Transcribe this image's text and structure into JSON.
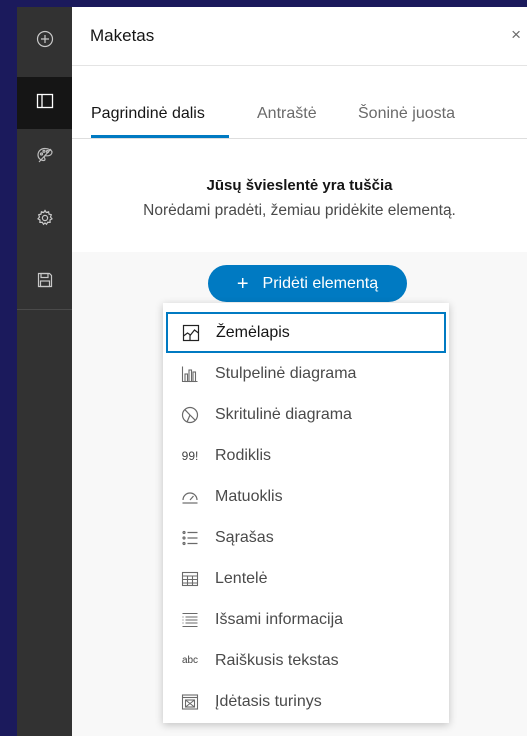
{
  "rail": {
    "items": [
      {
        "icon": "add-circle-icon"
      },
      {
        "icon": "layout-icon",
        "active": true
      },
      {
        "icon": "palette-icon"
      },
      {
        "icon": "gear-icon"
      },
      {
        "icon": "save-icon"
      }
    ]
  },
  "panel": {
    "title": "Maketas",
    "close": "×",
    "tabs": [
      {
        "label": "Pagrindinė dalis",
        "active": true
      },
      {
        "label": "Antraštė"
      },
      {
        "label": "Šoninė juosta"
      }
    ],
    "empty_title": "Jūsų švieslentė yra tuščia",
    "empty_subtitle": "Norėdami pradėti, žemiau pridėkite elementą.",
    "add_button": {
      "plus": "+",
      "label": "Pridėti elementą"
    }
  },
  "menu": {
    "items": [
      {
        "label": "Žemėlapis",
        "icon": "map-icon",
        "selected": true
      },
      {
        "label": "Stulpelinė diagrama",
        "icon": "bar-chart-icon"
      },
      {
        "label": "Skritulinė diagrama",
        "icon": "pie-chart-icon"
      },
      {
        "label": "Rodiklis",
        "icon": "indicator-icon",
        "glyph": "99!"
      },
      {
        "label": "Matuoklis",
        "icon": "gauge-icon"
      },
      {
        "label": "Sąrašas",
        "icon": "list-icon"
      },
      {
        "label": "Lentelė",
        "icon": "table-icon"
      },
      {
        "label": "Išsami informacija",
        "icon": "details-icon"
      },
      {
        "label": "Raiškusis tekstas",
        "icon": "rich-text-icon",
        "glyph": "abc"
      },
      {
        "label": "Įdėtasis turinys",
        "icon": "embed-icon"
      }
    ]
  }
}
